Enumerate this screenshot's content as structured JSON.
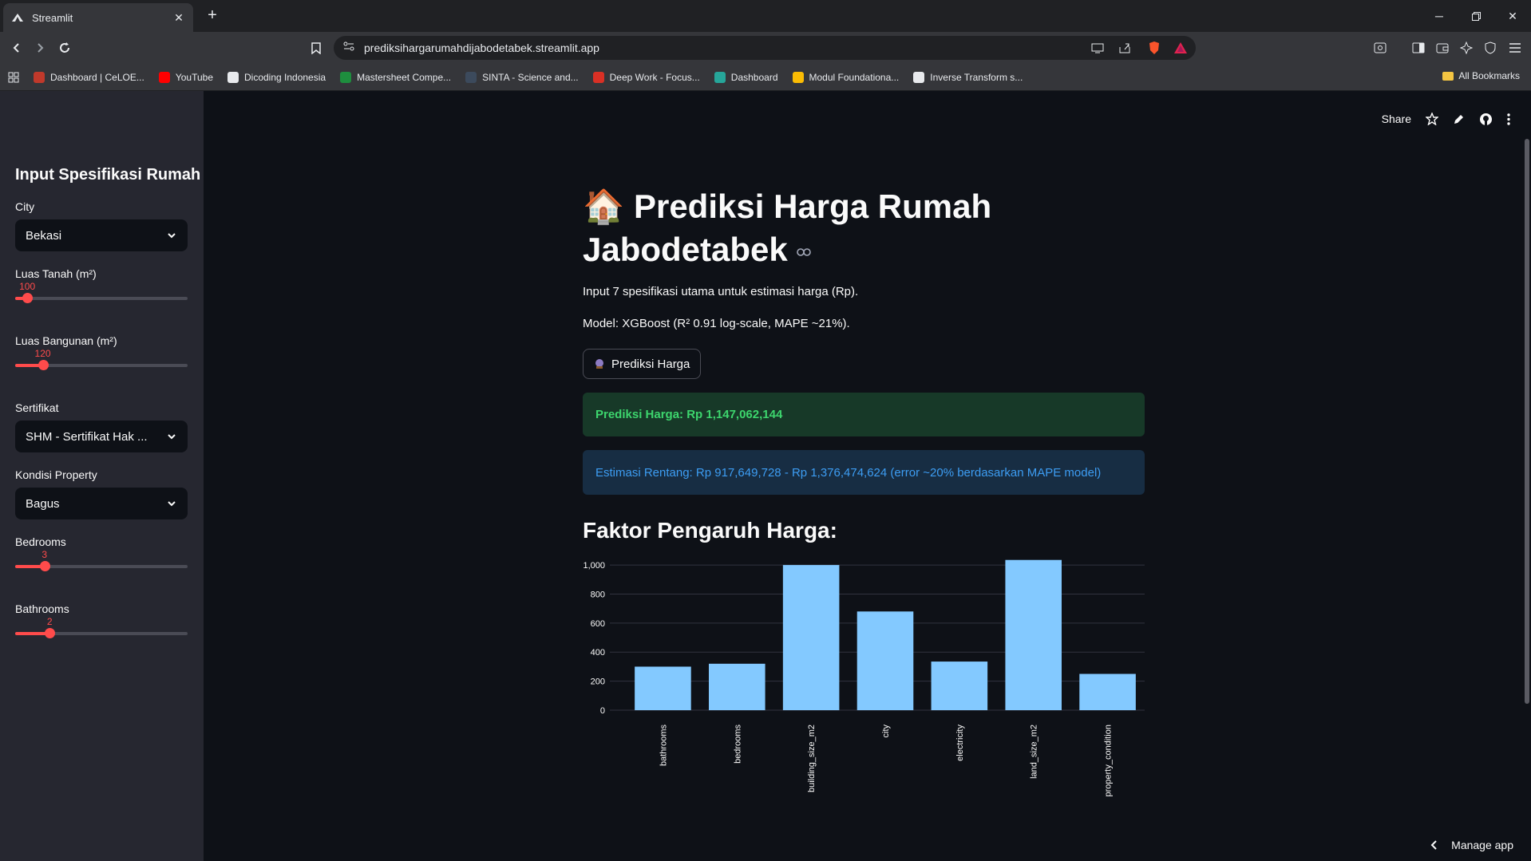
{
  "browser": {
    "tab_title": "Streamlit",
    "url": "prediksihargarumahdijabodetabek.streamlit.app",
    "bookmarks": [
      {
        "label": "Dashboard | CeLOE...",
        "color": "#c0392b"
      },
      {
        "label": "YouTube",
        "color": "#ff0000"
      },
      {
        "label": "Dicoding Indonesia",
        "color": "#e8eaed"
      },
      {
        "label": "Mastersheet Compe...",
        "color": "#1e8e3e"
      },
      {
        "label": "SINTA - Science and...",
        "color": "#3c4a5c"
      },
      {
        "label": "Deep Work - Focus...",
        "color": "#d93025"
      },
      {
        "label": "Dashboard",
        "color": "#26a69a"
      },
      {
        "label": "Modul Foundationa...",
        "color": "#fbbc04"
      },
      {
        "label": "Inverse Transform s...",
        "color": "#e8eaed"
      }
    ],
    "all_bookmarks": "All Bookmarks"
  },
  "sidebar": {
    "title": "Input Spesifikasi Rumah",
    "city": {
      "label": "City",
      "value": "Bekasi"
    },
    "land": {
      "label": "Luas Tanah (m²)",
      "value": "100",
      "fraction": 0.07
    },
    "building": {
      "label": "Luas Bangunan (m²)",
      "value": "120",
      "fraction": 0.16
    },
    "certificate": {
      "label": "Sertifikat",
      "value": "SHM - Sertifikat Hak ..."
    },
    "condition": {
      "label": "Kondisi Property",
      "value": "Bagus"
    },
    "bedrooms": {
      "label": "Bedrooms",
      "value": "3",
      "fraction": 0.17
    },
    "bathrooms": {
      "label": "Bathrooms",
      "value": "2",
      "fraction": 0.2
    }
  },
  "header": {
    "share": "Share"
  },
  "main": {
    "icon": "🏠",
    "title": "Prediksi Harga Rumah Jabodetabek",
    "intro": "Input 7 spesifikasi utama untuk estimasi harga (Rp).",
    "model": "Model: XGBoost (R² 0.91 log-scale, MAPE ~21%).",
    "button": "Prediksi Harga",
    "success": "Prediksi Harga: Rp 1,147,062,144",
    "info": "Estimasi Rentang: Rp 917,649,728 - Rp 1,376,474,624 (error ~20% berdasarkan MAPE model)",
    "chart_heading": "Faktor Pengaruh Harga:"
  },
  "chart_data": {
    "type": "bar",
    "categories": [
      "bathrooms",
      "bedrooms",
      "building_size_m2",
      "city",
      "electricity",
      "land_size_m2",
      "property_condition"
    ],
    "values": [
      300,
      320,
      1000,
      680,
      335,
      1035,
      250
    ],
    "ylim": [
      0,
      1050
    ],
    "yticks": [
      0,
      200,
      400,
      600,
      800,
      1000
    ],
    "ytick_labels": [
      "0",
      "200",
      "400",
      "600",
      "800",
      "1,000"
    ],
    "bar_color": "#83c9ff",
    "grid": true
  },
  "footer": {
    "manage": "Manage app"
  }
}
